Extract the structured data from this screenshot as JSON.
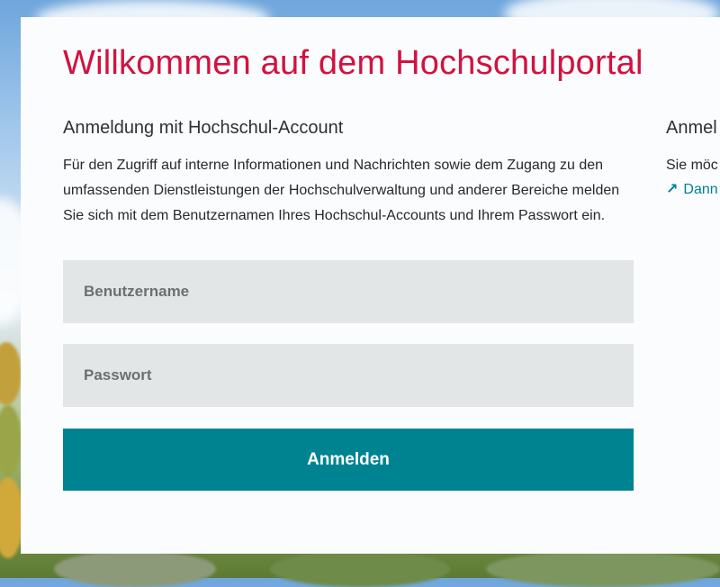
{
  "colors": {
    "title": "#d2123f",
    "accent": "#008391",
    "field_bg": "#e2e6e6",
    "card_bg": "#fbfcfd"
  },
  "page": {
    "title": "Willkommen auf dem Hochschulportal"
  },
  "login": {
    "heading": "Anmeldung mit Hochschul-Account",
    "description": "Für den Zugriff auf interne Informationen und Nachrichten sowie dem Zugang zu den umfassenden Dienstleistungen der Hochschulverwaltung und anderer Bereiche melden Sie sich mit dem Benutzernamen Ihres Hochschul-Accounts und Ihrem Passwort ein.",
    "username": {
      "placeholder": "Benutzername",
      "value": ""
    },
    "password": {
      "placeholder": "Passwort",
      "value": ""
    },
    "submit_label": "Anmelden"
  },
  "aside": {
    "heading": "Anmel",
    "text": "Sie möc",
    "link_icon": "arrow-up-right-icon",
    "link_label": "Dann"
  }
}
